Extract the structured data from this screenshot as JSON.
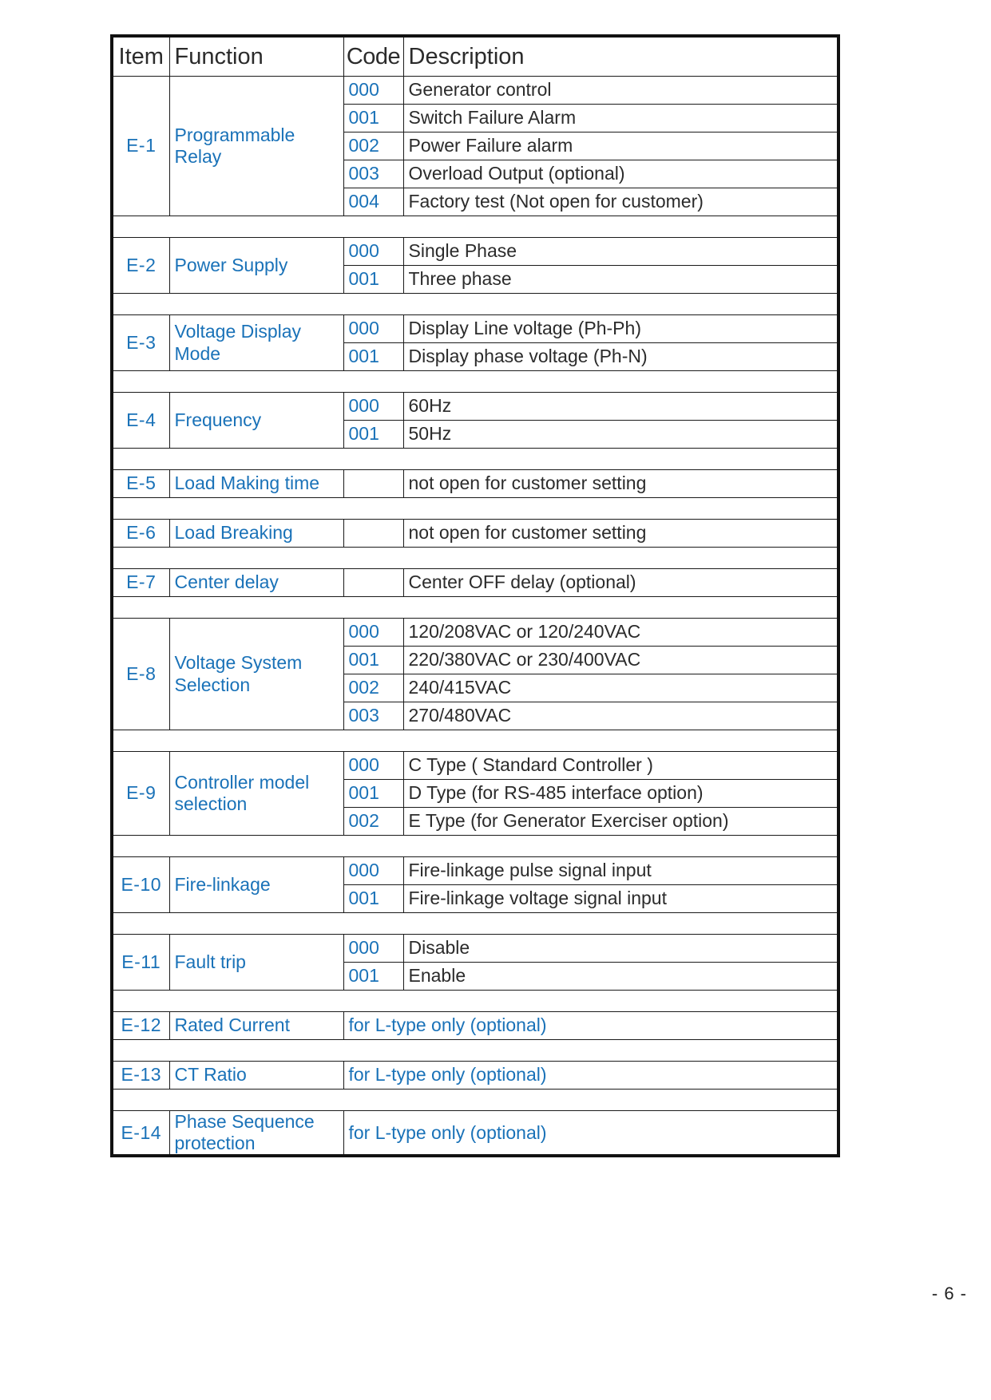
{
  "document": {
    "page_label": "- 6 -"
  },
  "table": {
    "headers": {
      "item": "Item",
      "function": "Function",
      "code": "Code",
      "description": "Description"
    },
    "groups": [
      {
        "item": "E-1",
        "function": "Programmable Relay",
        "function_lines": [
          "Programmable",
          "Relay"
        ],
        "rows": [
          {
            "code": "000",
            "description": "Generator control"
          },
          {
            "code": "001",
            "description": "Switch Failure Alarm"
          },
          {
            "code": "002",
            "description": "Power Failure alarm"
          },
          {
            "code": "003",
            "description": "Overload Output (optional)"
          },
          {
            "code": "004",
            "description": "Factory test (Not open for customer)"
          }
        ]
      },
      {
        "item": "E-2",
        "function": "Power Supply",
        "function_lines": [
          "Power Supply"
        ],
        "rows": [
          {
            "code": "000",
            "description": "Single Phase"
          },
          {
            "code": "001",
            "description": "Three phase"
          }
        ]
      },
      {
        "item": "E-3",
        "function": "Voltage Display Mode",
        "function_lines": [
          "Voltage Display",
          "Mode"
        ],
        "rows": [
          {
            "code": "000",
            "description": "Display Line voltage (Ph-Ph)"
          },
          {
            "code": "001",
            "description": "Display phase voltage (Ph-N)"
          }
        ]
      },
      {
        "item": "E-4",
        "function": "Frequency",
        "function_lines": [
          "Frequency"
        ],
        "rows": [
          {
            "code": "000",
            "description": "60Hz"
          },
          {
            "code": "001",
            "description": "50Hz"
          }
        ]
      },
      {
        "item": "E-5",
        "function": "Load Making time",
        "function_lines": [
          "Load Making time"
        ],
        "rows": [
          {
            "code": "",
            "description": "not open for customer setting"
          }
        ]
      },
      {
        "item": "E-6",
        "function": "Load Breaking",
        "function_lines": [
          "Load Breaking"
        ],
        "rows": [
          {
            "code": "",
            "description": "not open for customer setting"
          }
        ]
      },
      {
        "item": "E-7",
        "function": "Center delay",
        "function_lines": [
          "Center delay"
        ],
        "rows": [
          {
            "code": "",
            "description": "Center OFF delay (optional)"
          }
        ]
      },
      {
        "item": "E-8",
        "function": "Voltage System Selection",
        "function_lines": [
          "Voltage System",
          "Selection"
        ],
        "rows": [
          {
            "code": "000",
            "description": "120/208VAC or 120/240VAC"
          },
          {
            "code": "001",
            "description": "220/380VAC or 230/400VAC"
          },
          {
            "code": "002",
            "description": "240/415VAC"
          },
          {
            "code": "003",
            "description": "270/480VAC"
          }
        ]
      },
      {
        "item": "E-9",
        "function": "Controller model selection",
        "function_lines": [
          "Controller model",
          "selection"
        ],
        "rows": [
          {
            "code": "000",
            "description": "C Type  ( Standard Controller )"
          },
          {
            "code": "001",
            "description": "D Type  (for RS-485 interface option)"
          },
          {
            "code": "002",
            "description": "E Type  (for Generator Exerciser option)"
          }
        ]
      },
      {
        "item": "E-10",
        "function": "Fire-linkage",
        "function_lines": [
          "Fire-linkage"
        ],
        "rows": [
          {
            "code": "000",
            "description": "Fire-linkage pulse signal input"
          },
          {
            "code": "001",
            "description": "Fire-linkage voltage signal input"
          }
        ]
      },
      {
        "item": "E-11",
        "function": "Fault trip",
        "function_lines": [
          "Fault trip"
        ],
        "rows": [
          {
            "code": "000",
            "description": "Disable"
          },
          {
            "code": "001",
            "description": "Enable"
          }
        ]
      },
      {
        "item": "E-12",
        "function": "Rated Current",
        "function_lines": [
          "Rated Current"
        ],
        "merged_note": "for L-type only (optional)"
      },
      {
        "item": "E-13",
        "function": "CT Ratio",
        "function_lines": [
          "CT Ratio"
        ],
        "merged_note": "for L-type only (optional)"
      },
      {
        "item": "E-14",
        "function": "Phase Sequence protection",
        "function_lines": [
          "Phase Sequence",
          "protection"
        ],
        "merged_note": "for L-type only (optional)"
      }
    ]
  },
  "colors": {
    "accent_blue": "#1a72b8",
    "text_dark": "#2b2b2b",
    "border": "#1a1a1a"
  }
}
